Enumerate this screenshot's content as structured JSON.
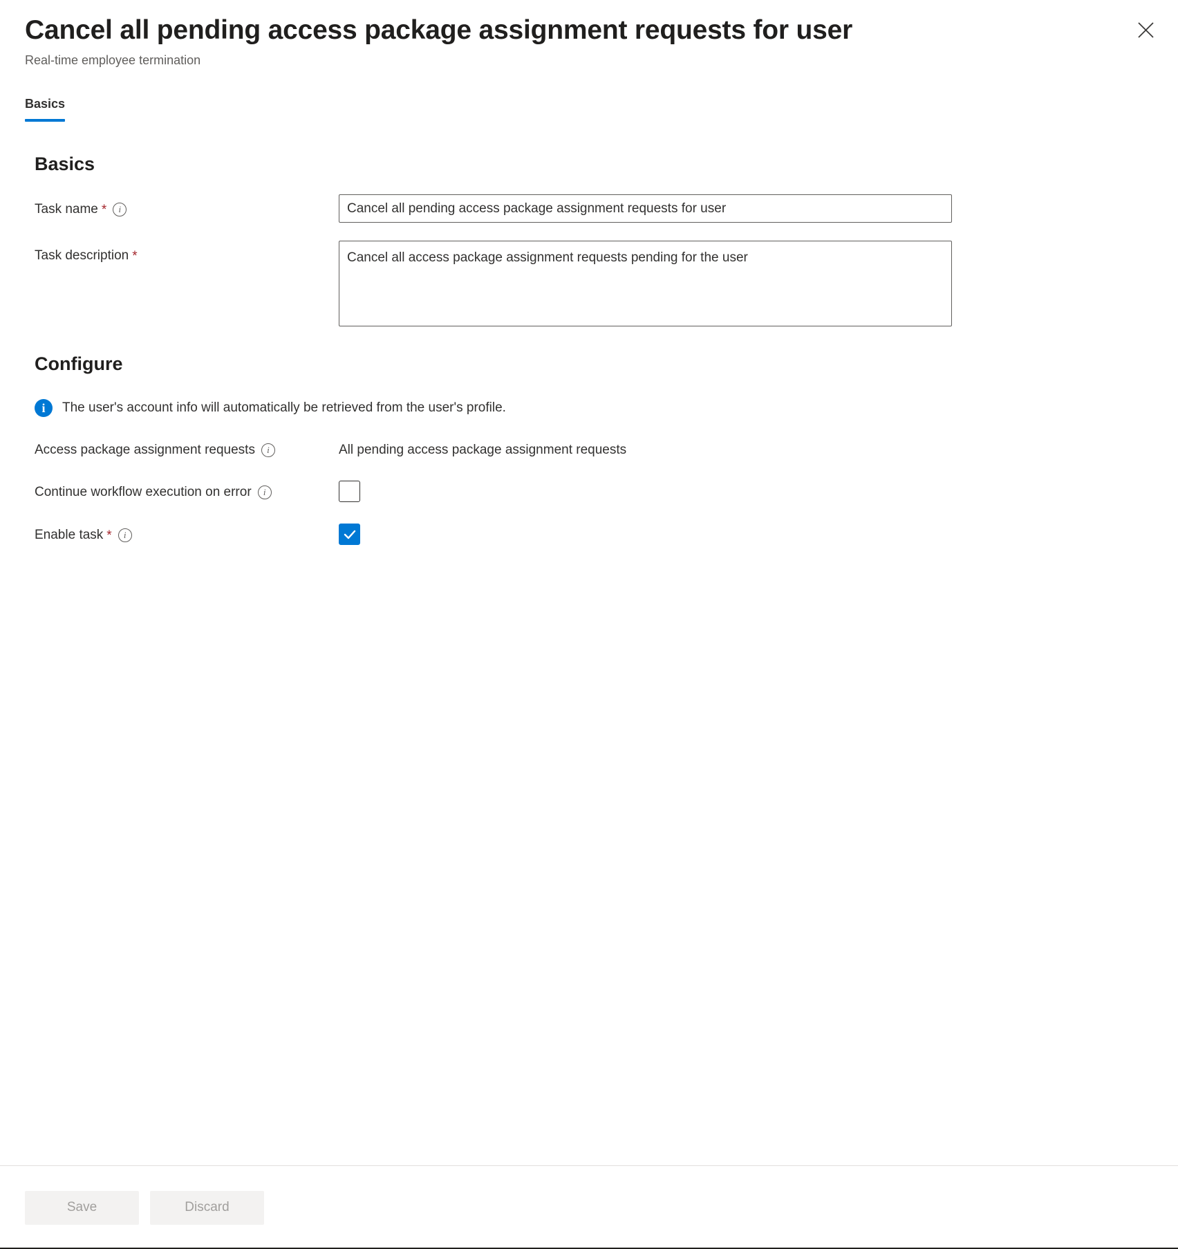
{
  "blade": {
    "title": "Cancel all pending access package assignment requests for user",
    "subtitle": "Real-time employee termination",
    "close_label": "Close",
    "close_icon": "close-icon"
  },
  "tabs": [
    {
      "label": "Basics",
      "active": true
    }
  ],
  "sections": {
    "basics": {
      "heading": "Basics",
      "task_name": {
        "label": "Task name",
        "required_marker": "*",
        "info_glyph": "i",
        "value": "Cancel all pending access package assignment requests for user",
        "placeholder": ""
      },
      "task_description": {
        "label": "Task description",
        "required_marker": "*",
        "value": "Cancel all access package assignment requests pending for the user",
        "placeholder": ""
      }
    },
    "configure": {
      "heading": "Configure",
      "info_banner": {
        "icon": "info-icon",
        "text": "The user's account info will automatically be retrieved from the user's profile."
      },
      "access_package_requests": {
        "label": "Access package assignment requests",
        "info_glyph": "i",
        "value": "All pending access package assignment requests"
      },
      "continue_on_error": {
        "label": "Continue workflow execution on error",
        "info_glyph": "i",
        "checked": false
      },
      "enable_task": {
        "label": "Enable task",
        "required_marker": "*",
        "info_glyph": "i",
        "checked": true
      }
    }
  },
  "footer": {
    "save_label": "Save",
    "discard_label": "Discard"
  },
  "colors": {
    "accent": "#0078d4",
    "required": "#a4262c",
    "text": "#323130",
    "subtle_text": "#605e5c",
    "disabled_button_bg": "#f3f2f1",
    "disabled_button_text": "#a19f9d"
  }
}
